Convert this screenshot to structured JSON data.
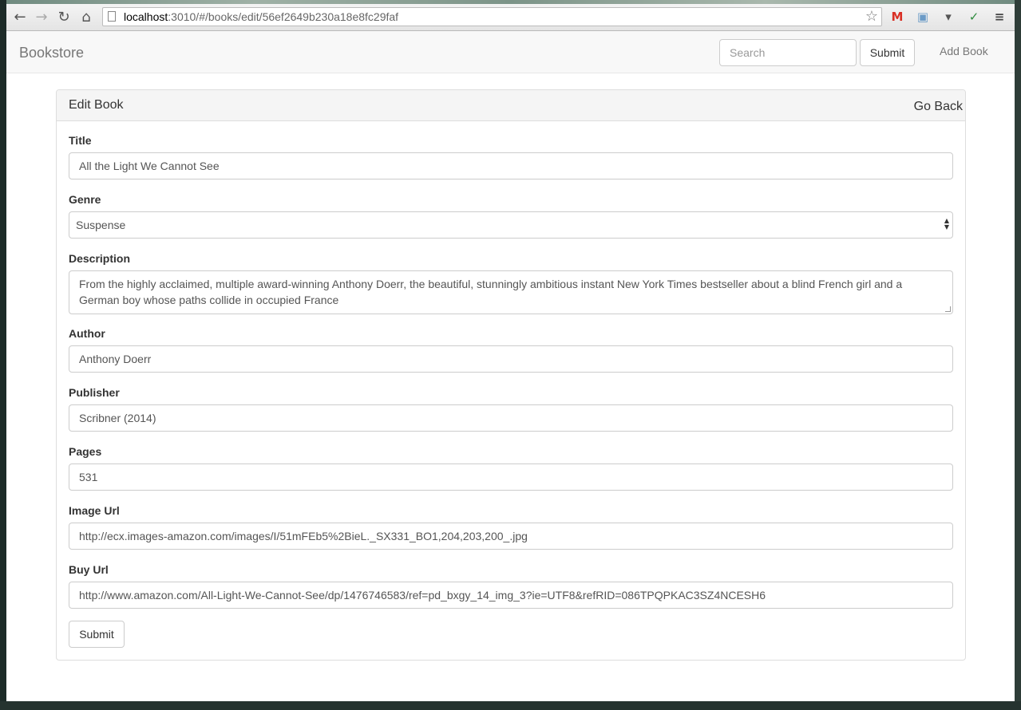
{
  "browser": {
    "url_host": "localhost",
    "url_path": ":3010/#/books/edit/56ef2649b230a18e8fc29faf"
  },
  "navbar": {
    "brand": "Bookstore",
    "search_placeholder": "Search",
    "search_submit": "Submit",
    "add_book": "Add Book"
  },
  "panel": {
    "title": "Edit Book",
    "go_back": "Go Back"
  },
  "form": {
    "title_label": "Title",
    "title_value": "All the Light We Cannot See",
    "genre_label": "Genre",
    "genre_value": "Suspense",
    "description_label": "Description",
    "description_value": "From the highly acclaimed, multiple award-winning Anthony Doerr, the beautiful, stunningly ambitious instant New York Times bestseller about a blind French girl and a German boy whose paths collide in occupied France",
    "author_label": "Author",
    "author_value": "Anthony Doerr",
    "publisher_label": "Publisher",
    "publisher_value": "Scribner (2014)",
    "pages_label": "Pages",
    "pages_value": "531",
    "image_url_label": "Image Url",
    "image_url_value": "http://ecx.images-amazon.com/images/I/51mFEb5%2BieL._SX331_BO1,204,203,200_.jpg",
    "buy_url_label": "Buy Url",
    "buy_url_value": "http://www.amazon.com/All-Light-We-Cannot-See/dp/1476746583/ref=pd_bxgy_14_img_3?ie=UTF8&refRID=086TPQPKAC3SZ4NCESH6",
    "submit_label": "Submit"
  },
  "icons": {
    "back": "arrow-left-icon",
    "forward": "arrow-right-icon",
    "reload": "reload-icon",
    "home": "home-icon",
    "star": "star-icon",
    "gmail": "gmail-icon",
    "camera": "camera-icon",
    "pocket": "pocket-icon",
    "check": "check-icon",
    "menu": "menu-icon"
  }
}
